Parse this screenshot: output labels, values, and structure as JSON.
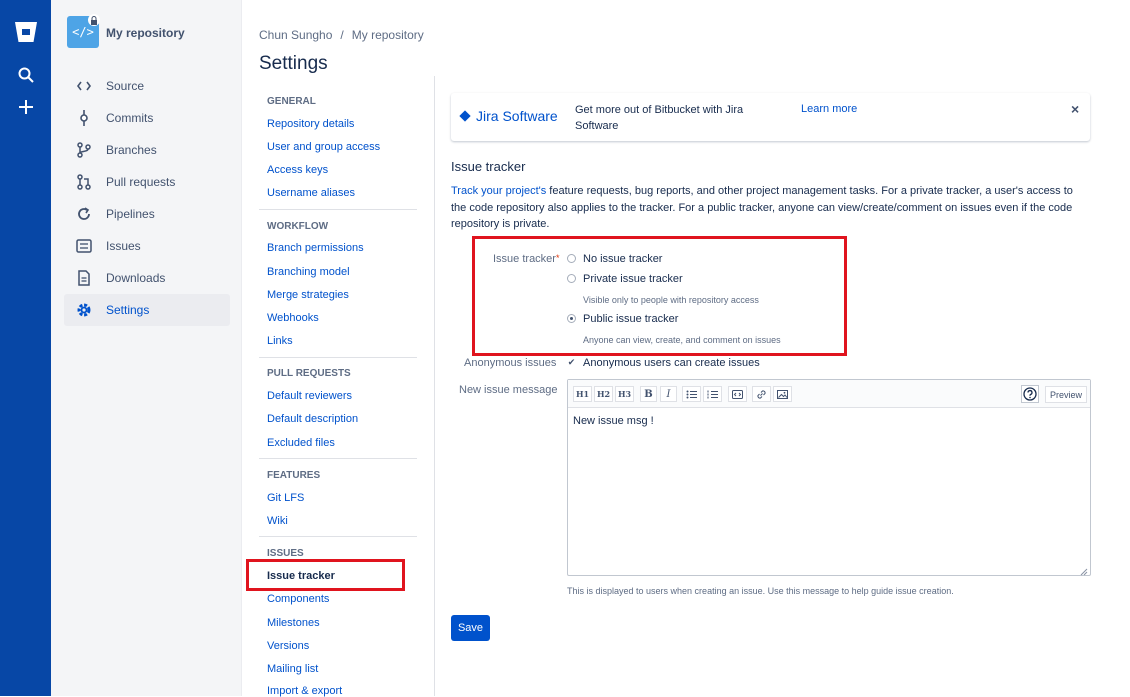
{
  "colors": {
    "global_nav": "#0747a6",
    "link": "#0052cc",
    "highlight": "#e0141e",
    "primary_button": "#0052cc"
  },
  "global_nav": {
    "items": [
      {
        "icon": "bitbucket-logo-icon"
      },
      {
        "icon": "search-icon"
      },
      {
        "icon": "plus-icon"
      }
    ]
  },
  "sidebar": {
    "repo_name": "My repository",
    "repo_avatar_glyph": "</>",
    "items": [
      {
        "label": "Source",
        "icon": "code-icon"
      },
      {
        "label": "Commits",
        "icon": "commit-icon"
      },
      {
        "label": "Branches",
        "icon": "branch-icon"
      },
      {
        "label": "Pull requests",
        "icon": "pull-request-icon"
      },
      {
        "label": "Pipelines",
        "icon": "pipelines-icon"
      },
      {
        "label": "Issues",
        "icon": "issues-icon"
      },
      {
        "label": "Downloads",
        "icon": "downloads-icon"
      },
      {
        "label": "Settings",
        "icon": "gear-icon",
        "active": true
      }
    ]
  },
  "breadcrumb": {
    "owner": "Chun Sungho",
    "separator": "/",
    "repo": "My repository"
  },
  "page_title": "Settings",
  "settings_nav": {
    "sections": [
      {
        "title": "GENERAL",
        "links": [
          "Repository details",
          "User and group access",
          "Access keys",
          "Username aliases"
        ]
      },
      {
        "title": "WORKFLOW",
        "links": [
          "Branch permissions",
          "Branching model",
          "Merge strategies",
          "Webhooks",
          "Links"
        ]
      },
      {
        "title": "PULL REQUESTS",
        "links": [
          "Default reviewers",
          "Default description",
          "Excluded files"
        ]
      },
      {
        "title": "FEATURES",
        "links": [
          "Git LFS",
          "Wiki"
        ]
      },
      {
        "title": "ISSUES",
        "links": [
          "Issue tracker",
          "Components",
          "Milestones",
          "Versions",
          "Mailing list",
          "Import & export"
        ]
      }
    ],
    "active": "Issue tracker"
  },
  "banner": {
    "product": "Jira Software",
    "text": "Get more out of Bitbucket with Jira Software",
    "link": "Learn more",
    "close": "×"
  },
  "issue_tracker": {
    "title": "Issue tracker",
    "description_link": "Track your project's",
    "description_rest": " feature requests, bug reports, and other project management tasks. For a private tracker, a user's access to the code repository also applies to the tracker. For a public tracker, anyone can view/create/comment on issues even if the code repository is private.",
    "field_label": "Issue tracker",
    "required_mark": "*",
    "options": [
      {
        "label": "No issue tracker",
        "help": "",
        "selected": false
      },
      {
        "label": "Private issue tracker",
        "help": "Visible only to people with repository access",
        "selected": false
      },
      {
        "label": "Public issue tracker",
        "help": "Anyone can view, create, and comment on issues",
        "selected": true
      }
    ],
    "anonymous_label": "Anonymous issues",
    "anonymous_checkbox": "Anonymous users can create issues",
    "anonymous_checked": true,
    "message_label": "New issue message",
    "toolbar": [
      "H1",
      "H2",
      "H3",
      "B",
      "I"
    ],
    "preview_label": "Preview",
    "message_value": "New issue msg !",
    "message_help": "This is displayed to users when creating an issue. Use this message to help guide issue creation.",
    "save_label": "Save"
  }
}
